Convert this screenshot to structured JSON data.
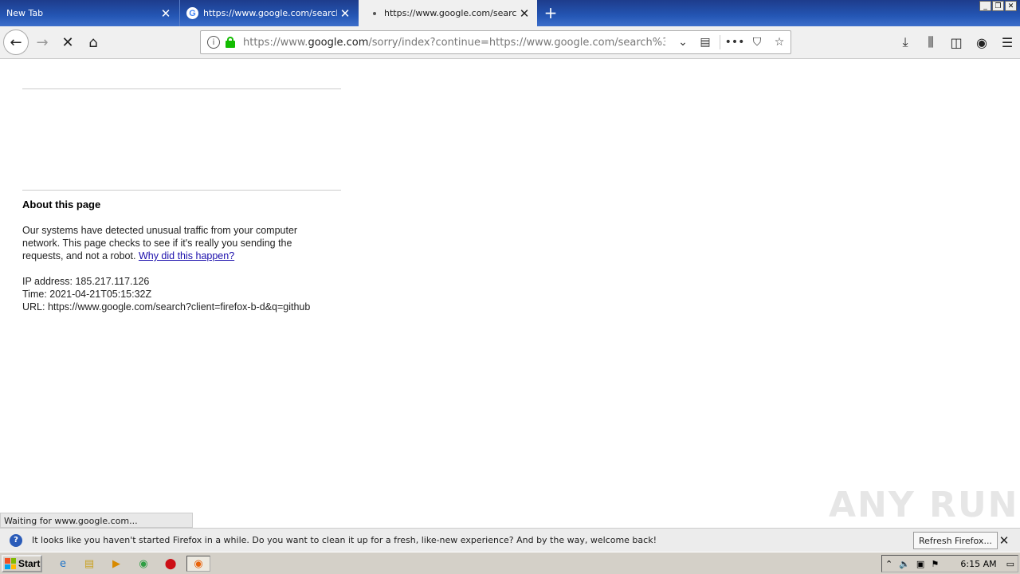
{
  "tabs": [
    {
      "label": "New Tab",
      "active": false
    },
    {
      "label": "https://www.google.com/search?c",
      "active": false
    },
    {
      "label": "https://www.google.com/search?c",
      "active": true
    }
  ],
  "url": {
    "scheme": "https://www.",
    "host": "google.com",
    "path": "/sorry/index?continue=https://www.google.com/search%3Fclient%3"
  },
  "page": {
    "heading": "About this page",
    "para1": "Our systems have detected unusual traffic from your computer network. This page checks to see if it's really you sending the requests, and not a robot. ",
    "link": "Why did this happen?",
    "ip": "IP address: 185.217.117.126",
    "time": "Time: 2021-04-21T05:15:32Z",
    "url": "URL: https://www.google.com/search?client=firefox-b-d&q=github"
  },
  "status": "Waiting for www.google.com...",
  "notification": {
    "text": "It looks like you haven't started Firefox in a while. Do you want to clean it up for a fresh, like-new experience? And by the way, welcome back!",
    "button": "Refresh Firefox..."
  },
  "taskbar": {
    "start": "Start",
    "clock": "6:15 AM"
  },
  "watermark": "ANY RUN"
}
